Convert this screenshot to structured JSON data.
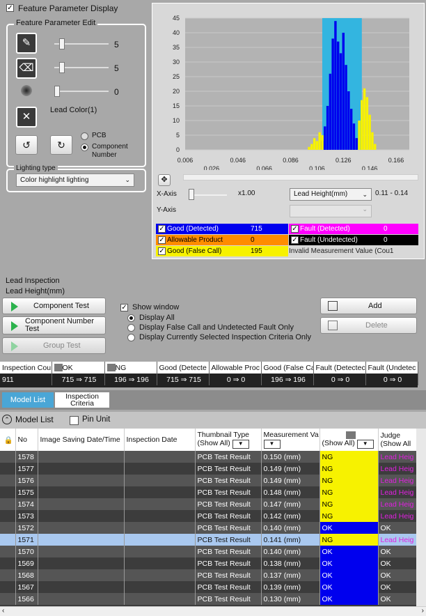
{
  "feature_panel": {
    "display_label": "Feature Parameter Display",
    "display_checked": true,
    "edit_title": "Feature Parameter Edit",
    "slider_values": [
      "5",
      "5",
      "0"
    ],
    "slider_levels": [
      0.1,
      0.1,
      0.0
    ],
    "lead_color_label": "Lead Color(1)",
    "radio_pcb": "PCB",
    "radio_component": "Component Number",
    "radio_selected": "component"
  },
  "lighting": {
    "group_title": "Lighting type",
    "selected": "Color highlight lighting"
  },
  "histogram": {
    "x_axis_label": "X-Axis",
    "y_axis_label": "Y-Axis",
    "zoom": "x1.00",
    "x_param": "Lead Height(mm)",
    "range": "0.11 - 0.14",
    "y_ticks": [
      "45",
      "40",
      "35",
      "30",
      "25",
      "20",
      "15",
      "10",
      "5",
      "0"
    ],
    "x_ticks_top": [
      "0.006",
      "0.046",
      "0.086",
      "0.126",
      "0.166"
    ],
    "x_ticks_bottom": [
      "0.026",
      "0.066",
      "0.106",
      "0.146"
    ]
  },
  "chart_data": {
    "type": "bar",
    "x_range": [
      0.006,
      0.176
    ],
    "ylim": [
      0,
      45
    ],
    "highlight_range": [
      0.11,
      0.14
    ],
    "series": [
      {
        "name": "Good (Detected)",
        "color": "#0000ee",
        "x": [
          0.11,
          0.112,
          0.114,
          0.116,
          0.118,
          0.12,
          0.122,
          0.124,
          0.126,
          0.128,
          0.13,
          0.132,
          0.134,
          0.136
        ],
        "values": [
          3,
          8,
          15,
          26,
          38,
          44,
          37,
          33,
          40,
          29,
          20,
          14,
          9,
          4
        ]
      },
      {
        "name": "Good (False Call)",
        "color": "#f7f200",
        "x": [
          0.1,
          0.102,
          0.104,
          0.106,
          0.108,
          0.11,
          0.138,
          0.14,
          0.142,
          0.144,
          0.146,
          0.148,
          0.15
        ],
        "values": [
          1,
          2,
          4,
          3,
          6,
          5,
          10,
          17,
          21,
          18,
          12,
          6,
          2
        ]
      }
    ]
  },
  "legend": {
    "good_detected": {
      "label": "Good (Detected)",
      "value": "715",
      "color": "#0000ee"
    },
    "allowable": {
      "label": "Allowable Product",
      "value": "0",
      "color": "#ff8c00"
    },
    "good_false": {
      "label": "Good (False Call)",
      "value": "195",
      "color": "#f7f200"
    },
    "fault_detected": {
      "label": "Fault (Detected)",
      "value": "0",
      "color": "#ff00ff"
    },
    "fault_undetected": {
      "label": "Fault (Undetected)",
      "value": "0",
      "color": "#000000"
    },
    "invalid": {
      "label": "Invalid Measurement Value (Cou1"
    }
  },
  "inspection": {
    "title": "Lead Inspection",
    "subtitle": "Lead Height(mm)",
    "component_test": "Component Test",
    "component_number_test": "Component Number Test",
    "group_test": "Group Test",
    "show_window": "Show window",
    "opt_all": "Display All",
    "opt_false": "Display False Call and Undetected Fault Only",
    "opt_current": "Display Currently Selected Inspection Criteria Only",
    "add": "Add",
    "delete": "Delete"
  },
  "summary": {
    "headers": [
      "Inspection Cou",
      "OK",
      "NG",
      "Good (Detecte",
      "Allowable Proc",
      "Good (False Ca",
      "Fault (Detectec",
      "Fault (Undetec"
    ],
    "values": [
      "911",
      "715 ⇒ 715",
      "196 ⇒ 196",
      "715 ⇒ 715",
      "0 ⇒ 0",
      "196 ⇒ 196",
      "0 ⇒ 0",
      "0 ⇒ 0"
    ]
  },
  "tabs": [
    "Model List",
    "Inspection Criteria"
  ],
  "model_list": {
    "title": "Model List",
    "pin_unit": "Pin Unit",
    "columns": {
      "no": "No",
      "image_date": "Image Saving Date/Time",
      "insp_date": "Inspection Date",
      "thumb": "Thumbnail Type",
      "thumb_filter": "(Show All)",
      "meas": "Measurement Va",
      "show_all": "(Show All)",
      "judge": "Judge",
      "judge_filter": "(Show All"
    },
    "rows": [
      {
        "no": "1578",
        "thumb": "PCB Test Result",
        "meas": "0.150 (mm)",
        "ng": "NG",
        "judge": "Lead Heig"
      },
      {
        "no": "1577",
        "thumb": "PCB Test Result",
        "meas": "0.149 (mm)",
        "ng": "NG",
        "judge": "Lead Heig"
      },
      {
        "no": "1576",
        "thumb": "PCB Test Result",
        "meas": "0.149 (mm)",
        "ng": "NG",
        "judge": "Lead Heig"
      },
      {
        "no": "1575",
        "thumb": "PCB Test Result",
        "meas": "0.148 (mm)",
        "ng": "NG",
        "judge": "Lead Heig"
      },
      {
        "no": "1574",
        "thumb": "PCB Test Result",
        "meas": "0.147 (mm)",
        "ng": "NG",
        "judge": "Lead Heig"
      },
      {
        "no": "1573",
        "thumb": "PCB Test Result",
        "meas": "0.142 (mm)",
        "ng": "NG",
        "judge": "Lead Heig"
      },
      {
        "no": "1572",
        "thumb": "PCB Test Result",
        "meas": "0.140 (mm)",
        "ng": "OK",
        "judge": "OK"
      },
      {
        "no": "1571",
        "thumb": "PCB Test Result",
        "meas": "0.141 (mm)",
        "ng": "NG",
        "judge": "Lead Heig"
      },
      {
        "no": "1570",
        "thumb": "PCB Test Result",
        "meas": "0.140 (mm)",
        "ng": "OK",
        "judge": "OK"
      },
      {
        "no": "1569",
        "thumb": "PCB Test Result",
        "meas": "0.138 (mm)",
        "ng": "OK",
        "judge": "OK"
      },
      {
        "no": "1568",
        "thumb": "PCB Test Result",
        "meas": "0.137 (mm)",
        "ng": "OK",
        "judge": "OK"
      },
      {
        "no": "1567",
        "thumb": "PCB Test Result",
        "meas": "0.139 (mm)",
        "ng": "OK",
        "judge": "OK"
      },
      {
        "no": "1566",
        "thumb": "PCB Test Result",
        "meas": "0.130 (mm)",
        "ng": "OK",
        "judge": "OK"
      }
    ],
    "selected_row": "1571"
  }
}
